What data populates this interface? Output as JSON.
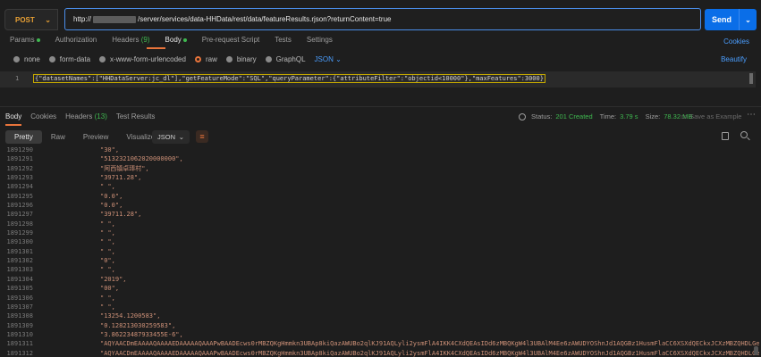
{
  "request": {
    "method": "POST",
    "url_prefix": "http://",
    "url_suffix": "/server/services/data-HHData/rest/data/featureResults.rjson?returnContent=true",
    "send_label": "Send"
  },
  "request_tabs": {
    "params": "Params",
    "authorization": "Authorization",
    "headers": "Headers",
    "headers_count": "(9)",
    "body": "Body",
    "prerequest": "Pre-request Script",
    "tests": "Tests",
    "settings": "Settings",
    "cookies": "Cookies"
  },
  "body_options": {
    "none": "none",
    "form_data": "form-data",
    "urlencoded": "x-www-form-urlencoded",
    "raw": "raw",
    "binary": "binary",
    "graphql": "GraphQL",
    "format": "JSON",
    "beautify": "Beautify"
  },
  "editor": {
    "line_number": "1",
    "code_text": "{\"datasetNames\":[\"HHDataServer:jc_dl\"],\"getFeatureMode\":\"SQL\",\"queryParameter\":{\"attributeFilter\":\"objectid<10000\"},\"maxFeatures\":3000}"
  },
  "response_tabs": {
    "body": "Body",
    "cookies": "Cookies",
    "headers": "Headers",
    "headers_count": "(13)",
    "test_results": "Test Results"
  },
  "response_status": {
    "status_label": "Status:",
    "status_value": "201 Created",
    "time_label": "Time:",
    "time_value": "3.79 s",
    "size_label": "Size:",
    "size_value": "78.32 MB",
    "save_example": "Save as Example"
  },
  "view_tabs": {
    "pretty": "Pretty",
    "raw": "Raw",
    "preview": "Preview",
    "visualize": "Visualize",
    "format": "JSON"
  },
  "response_lines": [
    {
      "n": "1891290",
      "v": "\"30\","
    },
    {
      "n": "1891291",
      "v": "\"5132321062020000000\","
    },
    {
      "n": "1891292",
      "v": "\"阿西镇卓琫村\","
    },
    {
      "n": "1891293",
      "v": "\"39711.28\","
    },
    {
      "n": "1891294",
      "v": "\" \","
    },
    {
      "n": "1891295",
      "v": "\"0.0\","
    },
    {
      "n": "1891296",
      "v": "\"0.0\","
    },
    {
      "n": "1891297",
      "v": "\"39711.28\","
    },
    {
      "n": "1891298",
      "v": "\" \","
    },
    {
      "n": "1891299",
      "v": "\" \","
    },
    {
      "n": "1891300",
      "v": "\" \","
    },
    {
      "n": "1891301",
      "v": "\" \","
    },
    {
      "n": "1891302",
      "v": "\"0\","
    },
    {
      "n": "1891303",
      "v": "\" \","
    },
    {
      "n": "1891304",
      "v": "\"2019\","
    },
    {
      "n": "1891305",
      "v": "\"00\","
    },
    {
      "n": "1891306",
      "v": "\" \","
    },
    {
      "n": "1891307",
      "v": "\" \","
    },
    {
      "n": "1891308",
      "v": "\"13254.1200583\","
    },
    {
      "n": "1891309",
      "v": "\"0.128213030259583\","
    },
    {
      "n": "1891310",
      "v": "\"3.86223487933455E-6\","
    },
    {
      "n": "1891311",
      "v": "\"AQYAACDmEAAAAQAAAAEDAAAAAQAAAPwBAADEcws0rMBZQKgHmmkn3UBAp8kiQazAWUBo2qlKJ91AQLyli2ysmFlA4IKK4CXdQEAsIDd6zMBQKgW4l3UBAlM4Ee6zAWUDYOShnJd1AQGBz1HusmFlaCC6XSXdQECkxJCXzMBZQHDLGe'"
    },
    {
      "n": "1891312",
      "v": "\"AQYAACDmEAAAAQAAAAEDAAAAAQAAAPwBAADEcws0rMBZQKgHmmkn3UBAp8kiQazAWUBo2qlKJ91AQLyli2ysmFlA4IKK4CXdQEAsIDd6zMBQKgW4l3UBAlM4Ee6zAWUDYOShnJd1AQGBz1HusmFlaCC6XSXdQECkxJCXzMBZQHDLGe'"
    }
  ]
}
